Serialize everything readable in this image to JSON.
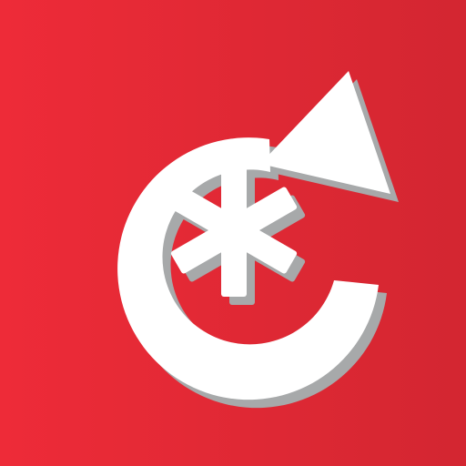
{
  "icon": {
    "name": "reset-asterisk-app-icon",
    "background_gradient": [
      "#EE2B38",
      "#D32631"
    ],
    "symbol_color": "#FFFFFF",
    "shadow_color": "#A7A9AA",
    "glyphs": [
      "refresh-arrow-icon",
      "asterisk-icon"
    ]
  }
}
